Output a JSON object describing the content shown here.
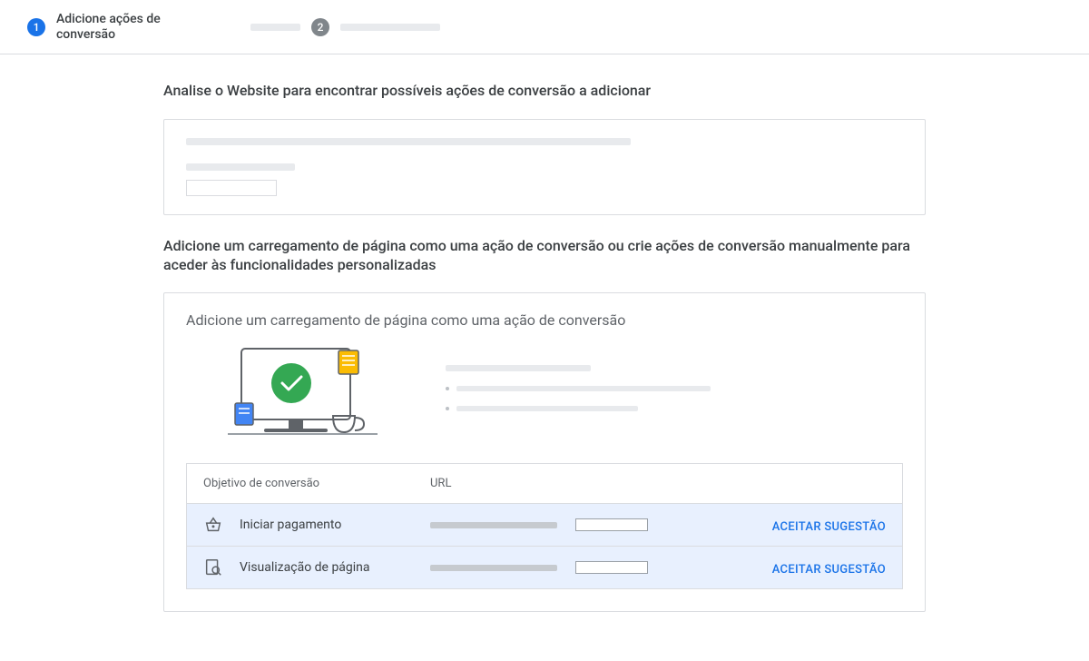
{
  "stepper": {
    "step1_num": "1",
    "step1_label": "Adicione ações de conversão",
    "step2_num": "2"
  },
  "scan": {
    "title": "Analise o Website para encontrar possíveis ações de conversão a adicionar"
  },
  "manual": {
    "title": "Adicione um carregamento de página como uma ação de conversão ou crie ações de conversão manualmente para aceder às funcionalidades personalizadas",
    "subtitle": "Adicione um carregamento de página como uma ação de conversão",
    "table": {
      "header_goal": "Objetivo de conversão",
      "header_url": "URL",
      "rows": [
        {
          "goal": "Iniciar pagamento",
          "action": "ACEITAR SUGESTÃO",
          "icon": "basket"
        },
        {
          "goal": "Visualização de página",
          "action": "ACEITAR SUGESTÃO",
          "icon": "page-search"
        }
      ]
    }
  }
}
